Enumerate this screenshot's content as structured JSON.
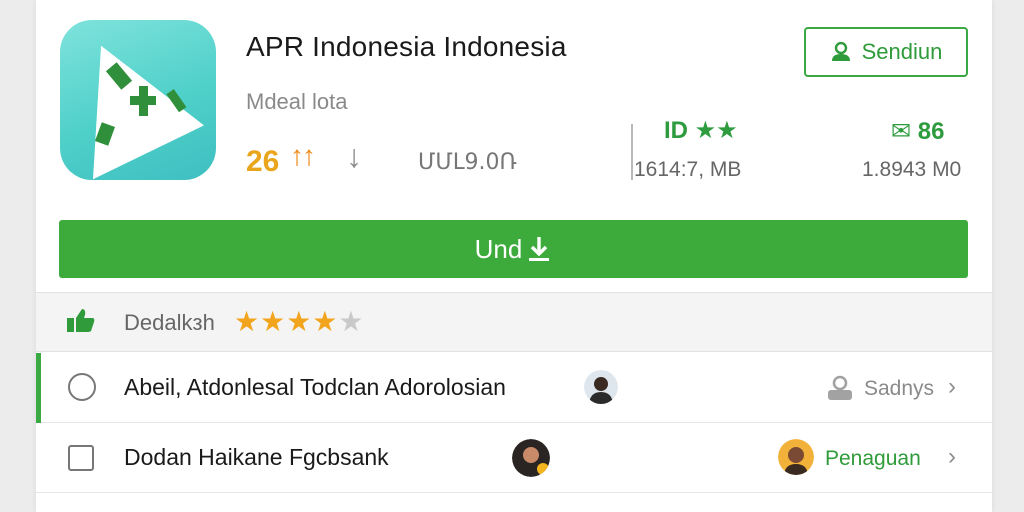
{
  "app": {
    "title": "APR Indonesia Indonesia",
    "subtitle": "Mdeal lota",
    "rating_value": "26",
    "rating_arrows": "↑↑",
    "rating_down": "↓",
    "version": "ՄՄԼ9.0Ռ"
  },
  "stats": {
    "stat1_icon": "ID ★★",
    "stat1_value": "1614:7, MB",
    "stat2_icon": "✉ 86",
    "stat2_value": "1.8943 M0"
  },
  "follow_button": {
    "label": "Sendiun",
    "icon": "person-icon"
  },
  "install_button": {
    "label": "Und",
    "icon": "download-icon"
  },
  "rating_strip": {
    "label": "Dedalkзh",
    "stars_filled": 4,
    "stars_total": 5,
    "filled_glyphs": "★★★★",
    "empty_glyphs": "★"
  },
  "rows": [
    {
      "text": "Abeil, Atdonlesal Todclan Adorolosian",
      "right_label": "Sadnys",
      "right_icon": "account-icon"
    },
    {
      "text": "Dodan  Haikane Fgcbsank",
      "right_label": "Penaguan",
      "right_icon": "avatar"
    }
  ],
  "colors": {
    "accent_green": "#3cab3b",
    "rating_orange": "#e9a51c",
    "star_orange": "#f2a41c",
    "icon_teal": "#4fd0c9"
  }
}
